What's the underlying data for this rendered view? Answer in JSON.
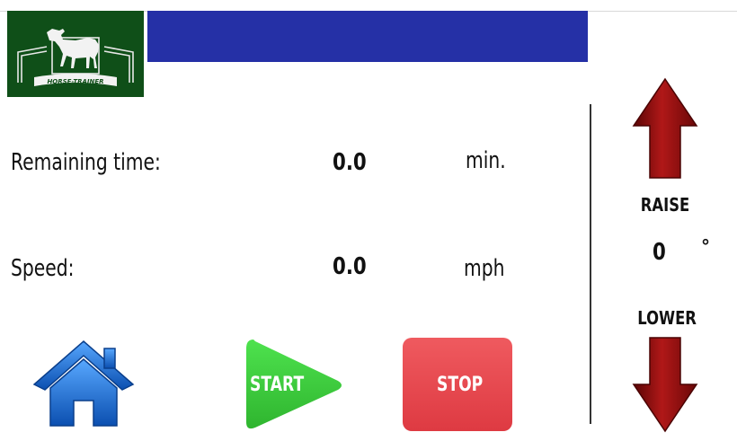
{
  "logo": {
    "text": "HORSE-TRAINER"
  },
  "readouts": {
    "remaining_time": {
      "label": "Remaining time:",
      "value": "0.0",
      "unit": "min."
    },
    "speed": {
      "label": "Speed:",
      "value": "0.0",
      "unit": "mph"
    }
  },
  "incline": {
    "raise_label": "RAISE",
    "value": "0",
    "unit": "°",
    "lower_label": "LOWER"
  },
  "buttons": {
    "home_icon": "home-icon",
    "start_label": "START",
    "stop_label": "STOP"
  },
  "colors": {
    "title_bar": "#2530a6",
    "logo_bg": "#0f4f18",
    "start": "#3ecf3e",
    "stop": "#e5434a",
    "arrow": "#8b0a0a",
    "home": "#1a6fd0"
  }
}
